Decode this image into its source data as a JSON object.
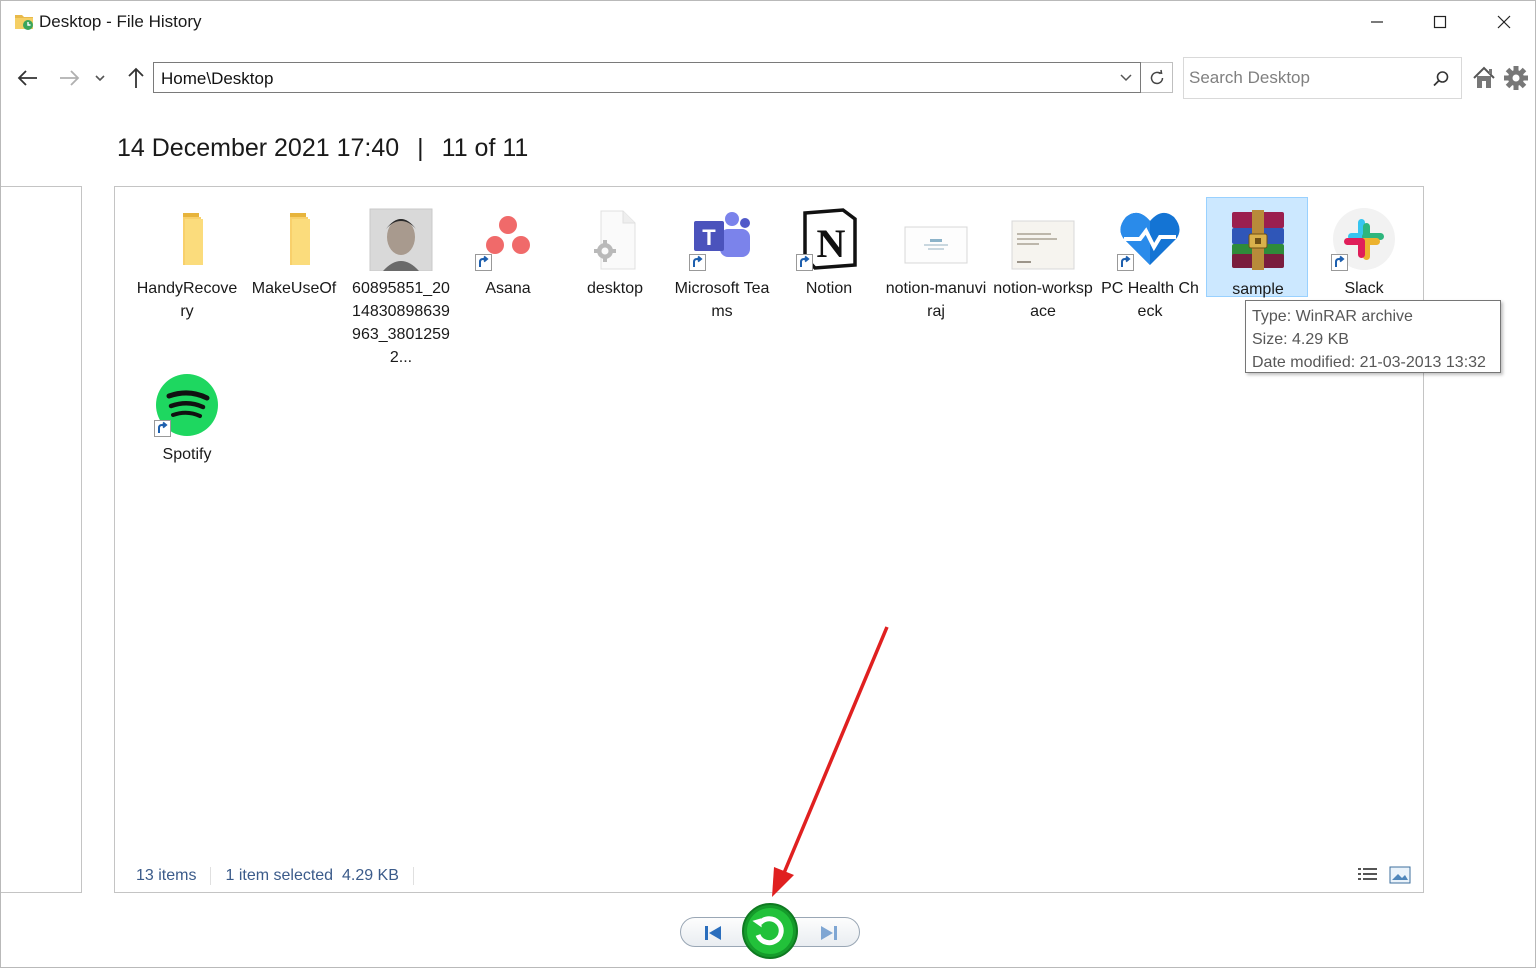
{
  "window": {
    "title": "Desktop - File History"
  },
  "nav": {
    "address": "Home\\Desktop",
    "search_placeholder": "Search Desktop"
  },
  "snapshot": {
    "datetime": "14 December 2021 17:40",
    "separator": "|",
    "position": "11 of 11"
  },
  "files": [
    {
      "label": "HandyRecovery",
      "icon": "folder-icon"
    },
    {
      "label": "MakeUseOf",
      "icon": "folder-icon"
    },
    {
      "label": "60895851_2014830898639963_38012592...",
      "icon": "photo-thumbnail"
    },
    {
      "label": "Asana",
      "icon": "asana-icon",
      "shortcut": true
    },
    {
      "label": "desktop",
      "icon": "settings-file-icon"
    },
    {
      "label": "Microsoft Teams",
      "icon": "teams-icon",
      "shortcut": true
    },
    {
      "label": "Notion",
      "icon": "notion-icon",
      "shortcut": true
    },
    {
      "label": "notion-manuviraj",
      "icon": "document-thumbnail"
    },
    {
      "label": "notion-workspace",
      "icon": "document-thumbnail"
    },
    {
      "label": "PC Health Check",
      "icon": "pc-health-icon",
      "shortcut": true
    },
    {
      "label": "sample",
      "icon": "winrar-icon",
      "selected": true
    },
    {
      "label": "Slack",
      "icon": "slack-icon",
      "shortcut": true
    },
    {
      "label": "Spotify",
      "icon": "spotify-icon",
      "shortcut": true
    }
  ],
  "tooltip": {
    "type": "Type: WinRAR archive",
    "size": "Size: 4.29 KB",
    "date": "Date modified: 21-03-2013 13:32"
  },
  "status": {
    "items": "13 items",
    "selected": "1 item selected  4.29 KB"
  },
  "colors": {
    "selection_bg": "#cce8ff",
    "selection_border": "#99d1ff",
    "restore_green": "#1fbf3a",
    "annotation_arrow": "#e02020"
  }
}
